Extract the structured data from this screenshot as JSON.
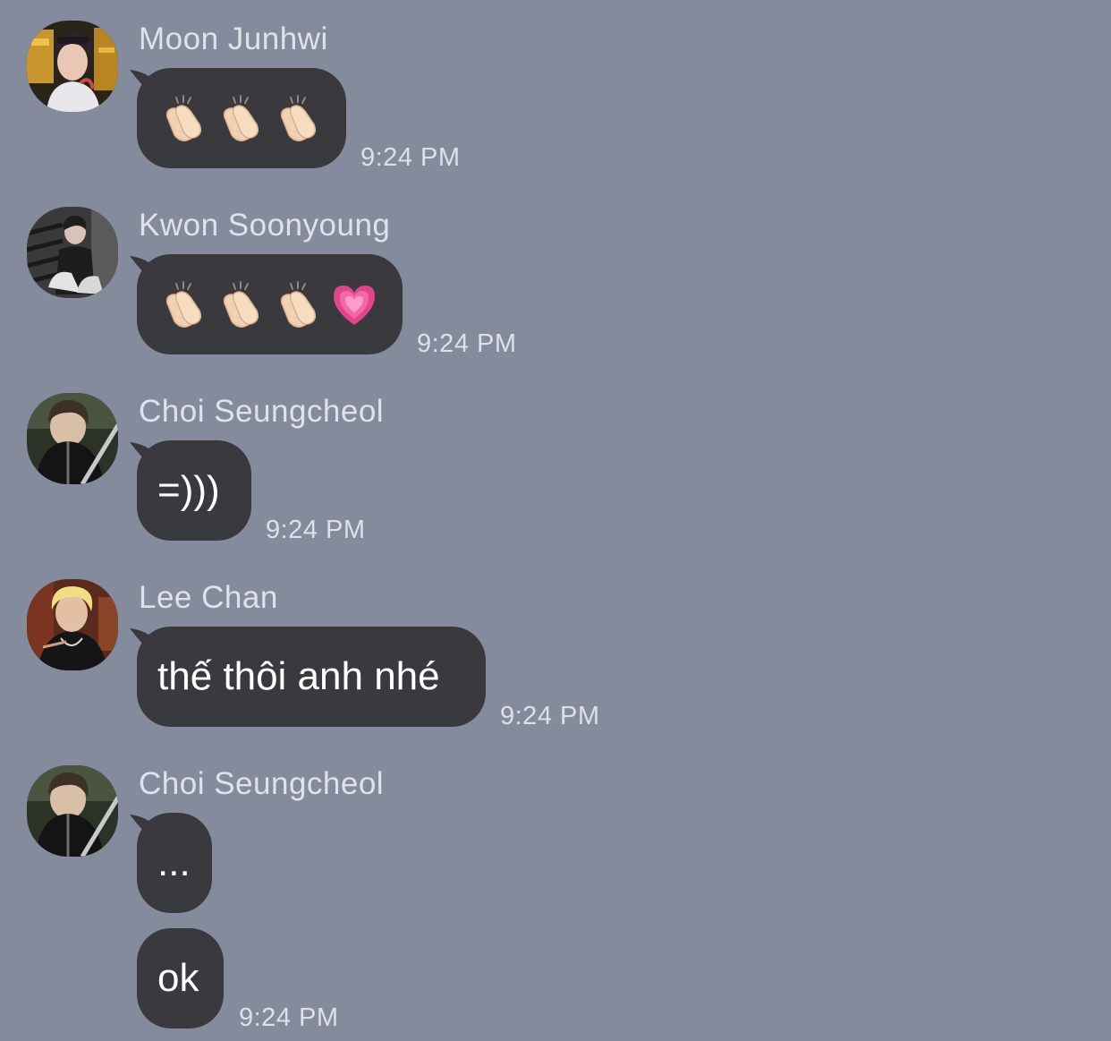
{
  "colors": {
    "background": "#838b9c",
    "bubble": "#3a3a3e",
    "sender_name": "#dfe2e8",
    "timestamp": "#dde0e6"
  },
  "messages": [
    {
      "sender": "Moon Junhwi",
      "avatar": "avatar-photo",
      "bubbles": [
        {
          "kind": "emoji",
          "emojis": [
            "clapping-hands-icon",
            "clapping-hands-icon",
            "clapping-hands-icon"
          ]
        }
      ],
      "time": "9:24 PM"
    },
    {
      "sender": "Kwon Soonyoung",
      "avatar": "avatar-photo",
      "bubbles": [
        {
          "kind": "emoji",
          "emojis": [
            "clapping-hands-icon",
            "clapping-hands-icon",
            "clapping-hands-icon",
            "growing-heart-icon"
          ]
        }
      ],
      "time": "9:24 PM"
    },
    {
      "sender": "Choi Seungcheol",
      "avatar": "avatar-photo",
      "bubbles": [
        {
          "kind": "text",
          "text": "=)))"
        }
      ],
      "time": "9:24 PM"
    },
    {
      "sender": "Lee Chan",
      "avatar": "avatar-photo",
      "bubbles": [
        {
          "kind": "text",
          "text": "thế thôi anh nhé"
        }
      ],
      "time": "9:24 PM"
    },
    {
      "sender": "Choi Seungcheol",
      "avatar": "avatar-photo",
      "bubbles": [
        {
          "kind": "text",
          "text": "..."
        },
        {
          "kind": "text",
          "text": "ok"
        }
      ],
      "time": "9:24 PM"
    }
  ]
}
